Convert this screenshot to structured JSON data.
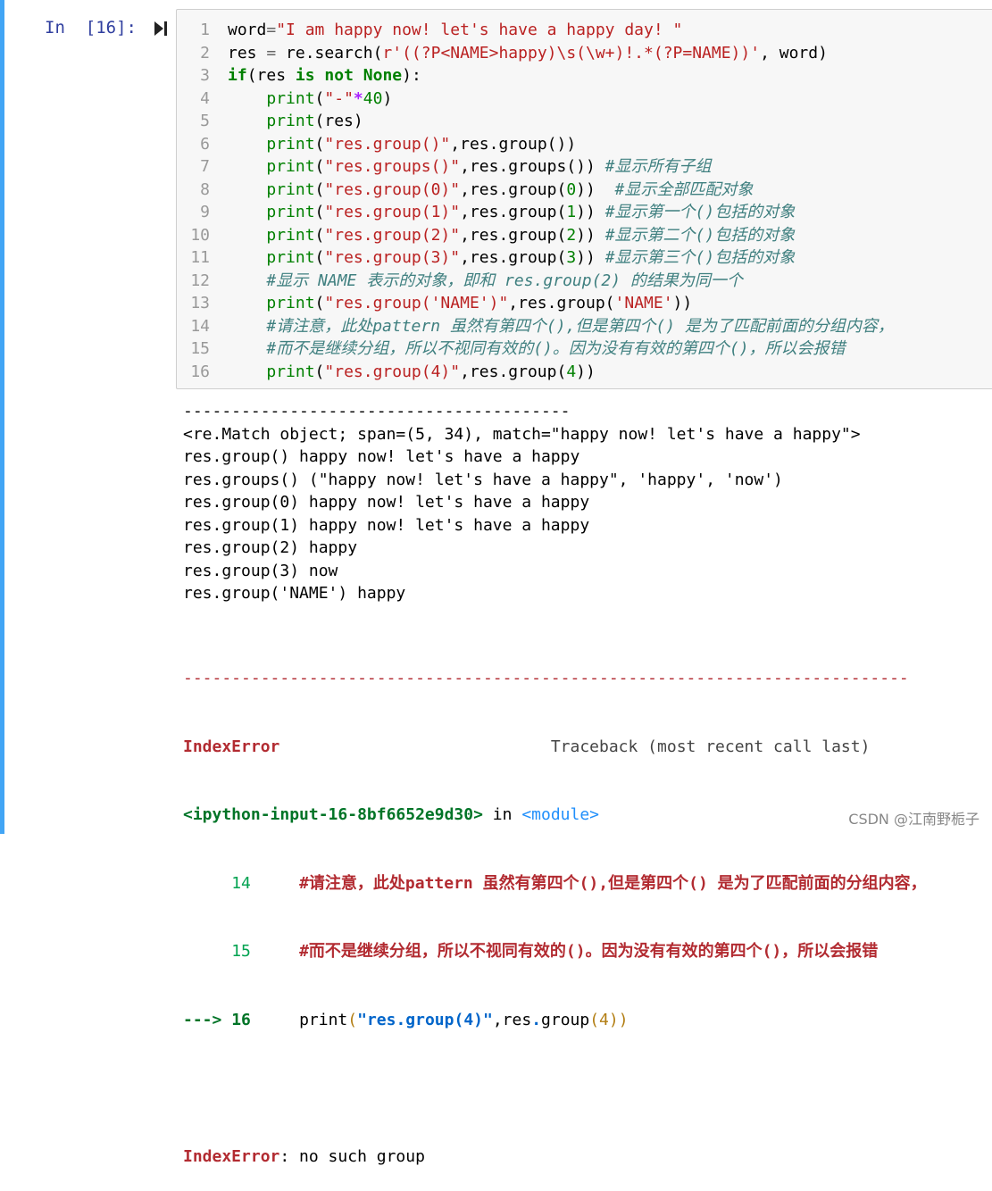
{
  "cell": {
    "prompt": "In  [16]:",
    "run_icon": "run-cell-icon",
    "line_numbers": [
      "1",
      "2",
      "3",
      "4",
      "5",
      "6",
      "7",
      "8",
      "9",
      "10",
      "11",
      "12",
      "13",
      "14",
      "15",
      "16"
    ],
    "code_lines": [
      "word=\"I am happy now! let's have a happy day! \"",
      "res = re.search(r'((?P<NAME>happy)\\s(\\w+)!.*(?P=NAME))', word)",
      "if(res is not None):",
      "    print(\"-\"*40)",
      "    print(res)",
      "    print(\"res.group()\",res.group())",
      "    print(\"res.groups()\",res.groups()) #显示所有子组",
      "    print(\"res.group(0)\",res.group(0))  #显示全部匹配对象",
      "    print(\"res.group(1)\",res.group(1)) #显示第一个()包括的对象",
      "    print(\"res.group(2)\",res.group(2)) #显示第二个()包括的对象",
      "    print(\"res.group(3)\",res.group(3)) #显示第三个()包括的对象",
      "    #显示 NAME 表示的对象，即和 res.group(2) 的结果为同一个",
      "    print(\"res.group('NAME')\",res.group('NAME'))",
      "    #请注意，此处pattern 虽然有第四个(),但是第四个() 是为了匹配前面的分组内容，",
      "    #而不是继续分组，所以不视同有效的()。因为没有有效的第四个()，所以会报错",
      "    print(\"res.group(4)\",res.group(4))"
    ]
  },
  "output": {
    "lines": [
      "----------------------------------------",
      "<re.Match object; span=(5, 34), match=\"happy now! let's have a happy\">",
      "res.group() happy now! let's have a happy",
      "res.groups() (\"happy now! let's have a happy\", 'happy', 'now')",
      "res.group(0) happy now! let's have a happy",
      "res.group(1) happy now! let's have a happy",
      "res.group(2) happy",
      "res.group(3) now",
      "res.group('NAME') happy"
    ]
  },
  "traceback": {
    "rule": "---------------------------------------------------------------------------",
    "error_name": "IndexError",
    "header_right": "Traceback (most recent call last)",
    "location_file": "<ipython-input-16-8bf6652e9d30>",
    "location_in": " in ",
    "location_module": "<module>",
    "ln14": "14",
    "ln14_text": "#请注意，此处pattern 虽然有第四个(),但是第四个() 是为了匹配前面的分组内容，",
    "ln15": "15",
    "ln15_text": "#而不是继续分组，所以不视同有效的()。因为没有有效的第四个()，所以会报错",
    "arrow": "--->",
    "ln16": "16",
    "ln16_print": "print",
    "ln16_paren_open": "(",
    "ln16_str": "\"res.group(4)\"",
    "ln16_mid": ",res",
    "ln16_dot": ".",
    "ln16_group": "group",
    "ln16_args": "(4)",
    "ln16_close": ")",
    "final_name": "IndexError",
    "final_msg": ": no such group"
  },
  "watermark": "CSDN @江南野栀子",
  "colors": {
    "cell_bar": "#42a5f5",
    "prompt": "#303f9f",
    "keyword": "#008000",
    "string": "#ba2121",
    "comment": "#408080",
    "error": "#b22b31"
  }
}
